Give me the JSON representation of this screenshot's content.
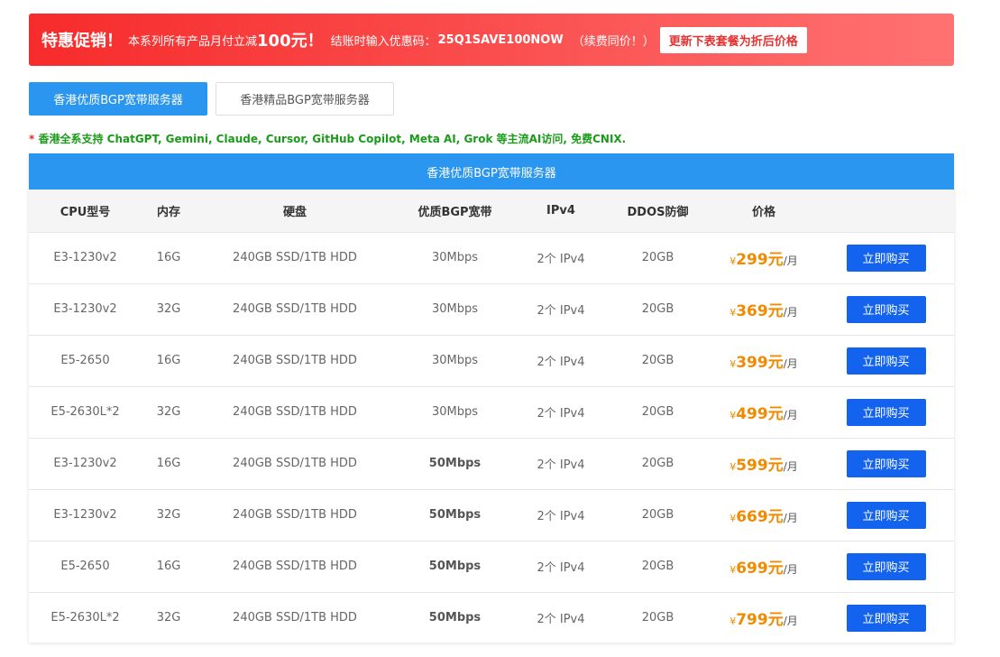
{
  "promo": {
    "headline": "特惠促销！",
    "desc_prefix": "本系列所有产品月付立减",
    "discount": "100元！",
    "code_label": "结账时输入优惠码：",
    "code": "25Q1SAVE100NOW",
    "renew_note": "（续费同价！）",
    "update_button": "更新下表套餐为折后价格"
  },
  "tabs": [
    {
      "label": "香港优质BGP宽带服务器",
      "active": true
    },
    {
      "label": "香港精品BGP宽带服务器",
      "active": false
    }
  ],
  "note": {
    "star": "*",
    "text": " 香港全系支持 ChatGPT, Gemini, Claude, Cursor, GitHub Copilot, Meta AI, Grok 等主流AI访问, 免费CNIX."
  },
  "panel": {
    "title": "香港优质BGP宽带服务器",
    "headers": [
      "CPU型号",
      "内存",
      "硬盘",
      "优质BGP宽带",
      "IPv4",
      "DDOS防御",
      "价格",
      ""
    ],
    "rows": [
      {
        "cpu": "E3-1230v2",
        "ram": "16G",
        "disk": "240GB SSD/1TB HDD",
        "bandwidth": "30Mbps",
        "bw_bold": false,
        "ipv4": "2个 IPv4",
        "ddos": "20GB",
        "currency": "¥",
        "price": "299元",
        "period": "/月",
        "buy": "立即购买"
      },
      {
        "cpu": "E3-1230v2",
        "ram": "32G",
        "disk": "240GB SSD/1TB HDD",
        "bandwidth": "30Mbps",
        "bw_bold": false,
        "ipv4": "2个 IPv4",
        "ddos": "20GB",
        "currency": "¥",
        "price": "369元",
        "period": "/月",
        "buy": "立即购买"
      },
      {
        "cpu": "E5-2650",
        "ram": "16G",
        "disk": "240GB SSD/1TB HDD",
        "bandwidth": "30Mbps",
        "bw_bold": false,
        "ipv4": "2个 IPv4",
        "ddos": "20GB",
        "currency": "¥",
        "price": "399元",
        "period": "/月",
        "buy": "立即购买"
      },
      {
        "cpu": "E5-2630L*2",
        "ram": "32G",
        "disk": "240GB SSD/1TB HDD",
        "bandwidth": "30Mbps",
        "bw_bold": false,
        "ipv4": "2个 IPv4",
        "ddos": "20GB",
        "currency": "¥",
        "price": "499元",
        "period": "/月",
        "buy": "立即购买"
      },
      {
        "cpu": "E3-1230v2",
        "ram": "16G",
        "disk": "240GB SSD/1TB HDD",
        "bandwidth": "50Mbps",
        "bw_bold": true,
        "ipv4": "2个 IPv4",
        "ddos": "20GB",
        "currency": "¥",
        "price": "599元",
        "period": "/月",
        "buy": "立即购买"
      },
      {
        "cpu": "E3-1230v2",
        "ram": "32G",
        "disk": "240GB SSD/1TB HDD",
        "bandwidth": "50Mbps",
        "bw_bold": true,
        "ipv4": "2个 IPv4",
        "ddos": "20GB",
        "currency": "¥",
        "price": "669元",
        "period": "/月",
        "buy": "立即购买"
      },
      {
        "cpu": "E5-2650",
        "ram": "16G",
        "disk": "240GB SSD/1TB HDD",
        "bandwidth": "50Mbps",
        "bw_bold": true,
        "ipv4": "2个 IPv4",
        "ddos": "20GB",
        "currency": "¥",
        "price": "699元",
        "period": "/月",
        "buy": "立即购买"
      },
      {
        "cpu": "E5-2630L*2",
        "ram": "32G",
        "disk": "240GB SSD/1TB HDD",
        "bandwidth": "50Mbps",
        "bw_bold": true,
        "ipv4": "2个 IPv4",
        "ddos": "20GB",
        "currency": "¥",
        "price": "799元",
        "period": "/月",
        "buy": "立即购买"
      }
    ]
  },
  "colors": {
    "accent_blue": "#2a96f0",
    "buy_button": "#1463ee",
    "price_orange": "#f08a00",
    "promo_red": "#f72b2b",
    "note_green": "#1a9b1a"
  }
}
